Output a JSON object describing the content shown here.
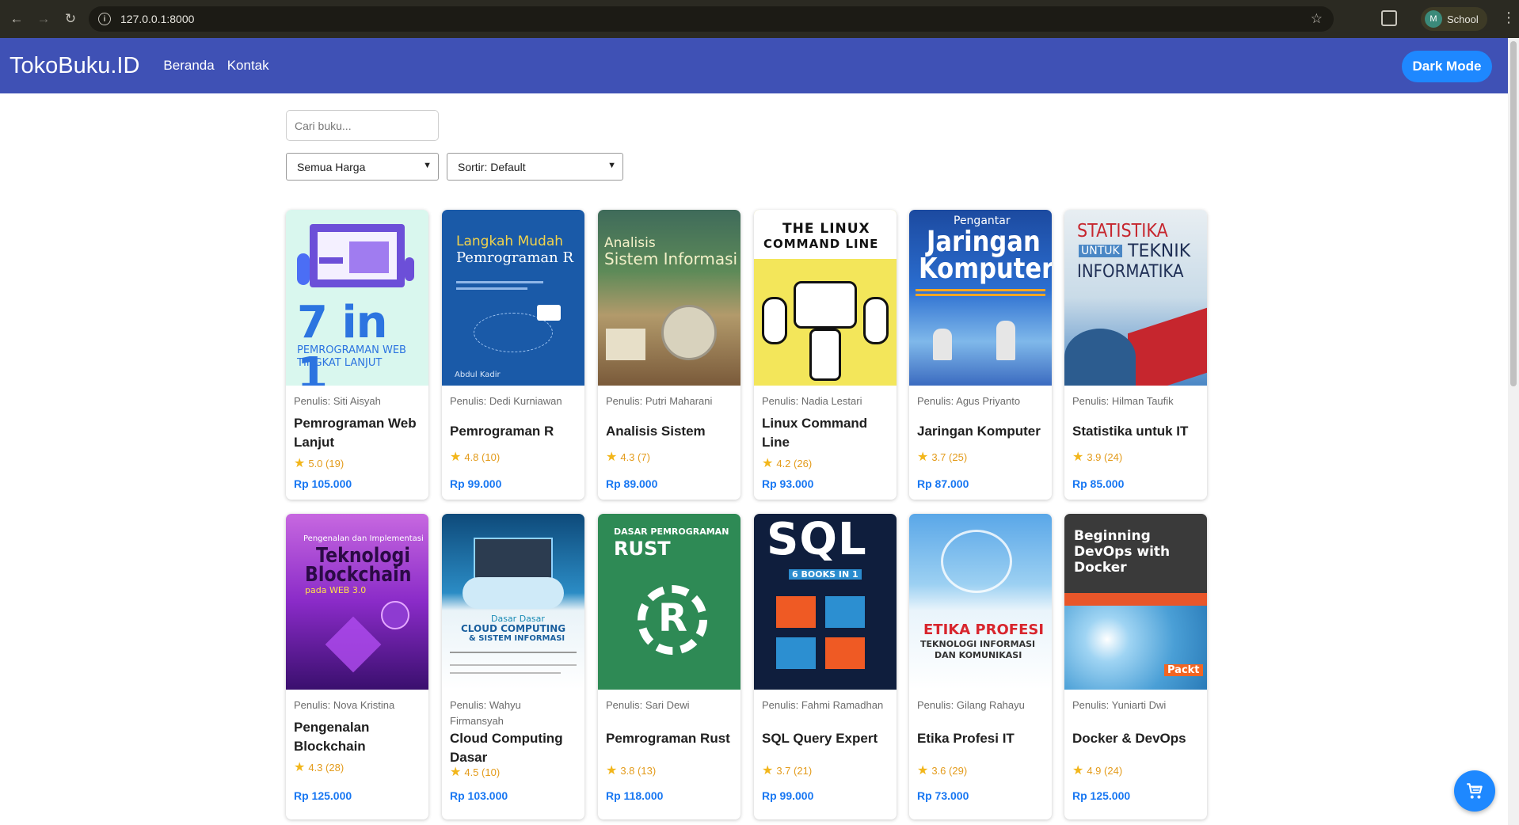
{
  "browser": {
    "url": "127.0.0.1:8000",
    "profile_initial": "M",
    "profile_name": "School"
  },
  "header": {
    "brand": "TokoBuku.ID",
    "nav": [
      "Beranda",
      "Kontak"
    ],
    "dark_mode_label": "Dark Mode"
  },
  "controls": {
    "search_placeholder": "Cari buku...",
    "price_filter": "Semua Harga",
    "sort": "Sortir: Default"
  },
  "books": [
    {
      "author": "Penulis: Siti Aisyah",
      "title": "Pemrograman Web Lanjut",
      "rating": "5.0 (19)",
      "price": "Rp 105.000",
      "cover_lines": [
        "7 in 1",
        "PEMROGRAMAN WEB",
        "TINGKAT LANJUT"
      ]
    },
    {
      "author": "Penulis: Dedi Kurniawan",
      "title": "Pemrograman R",
      "rating": "4.8 (10)",
      "price": "Rp 99.000",
      "cover_lines": [
        "Langkah Mudah",
        "Pemrograman R",
        "Abdul Kadir"
      ]
    },
    {
      "author": "Penulis: Putri Maharani",
      "title": "Analisis Sistem",
      "rating": "4.3 (7)",
      "price": "Rp 89.000",
      "cover_lines": [
        "Analisis",
        "Sistem Informasi"
      ]
    },
    {
      "author": "Penulis: Nadia Lestari",
      "title": "Linux Command Line",
      "rating": "4.2 (26)",
      "price": "Rp 93.000",
      "cover_lines": [
        "THE LINUX",
        "COMMAND LINE"
      ]
    },
    {
      "author": "Penulis: Agus Priyanto",
      "title": "Jaringan Komputer",
      "rating": "3.7 (25)",
      "price": "Rp 87.000",
      "cover_lines": [
        "Pengantar",
        "Jaringan",
        "Komputer"
      ]
    },
    {
      "author": "Penulis: Hilman Taufik",
      "title": "Statistika untuk IT",
      "rating": "3.9 (24)",
      "price": "Rp 85.000",
      "cover_lines": [
        "STATISTIKA",
        "UNTUK",
        "TEKNIK",
        "INFORMATIKA"
      ]
    },
    {
      "author": "Penulis: Nova Kristina",
      "title": "Pengenalan Blockchain",
      "rating": "4.3 (28)",
      "price": "Rp 125.000",
      "cover_lines": [
        "Pengenalan dan Implementasi",
        "Teknologi",
        "Blockchain",
        "pada WEB 3.0"
      ]
    },
    {
      "author": "Penulis: Wahyu Firmansyah",
      "title": "Cloud Computing Dasar",
      "rating": "4.5 (10)",
      "price": "Rp 103.000",
      "cover_lines": [
        "Dasar Dasar",
        "CLOUD COMPUTING",
        "& SISTEM INFORMASI"
      ]
    },
    {
      "author": "Penulis: Sari Dewi",
      "title": "Pemrograman Rust",
      "rating": "3.8 (13)",
      "price": "Rp 118.000",
      "cover_lines": [
        "DASAR PEMROGRAMAN",
        "RUST",
        "R"
      ]
    },
    {
      "author": "Penulis: Fahmi Ramadhan",
      "title": "SQL Query Expert",
      "rating": "3.7 (21)",
      "price": "Rp 99.000",
      "cover_lines": [
        "SQL",
        "6 BOOKS IN 1"
      ]
    },
    {
      "author": "Penulis: Gilang Rahayu",
      "title": "Etika Profesi IT",
      "rating": "3.6 (29)",
      "price": "Rp 73.000",
      "cover_lines": [
        "ETIKA PROFESI",
        "TEKNOLOGI INFORMASI",
        "DAN KOMUNIKASI"
      ]
    },
    {
      "author": "Penulis: Yuniarti Dwi",
      "title": "Docker & DevOps",
      "rating": "4.9 (24)",
      "price": "Rp 125.000",
      "cover_lines": [
        "Beginning",
        "DevOps with",
        "Docker",
        "Packt"
      ]
    }
  ]
}
